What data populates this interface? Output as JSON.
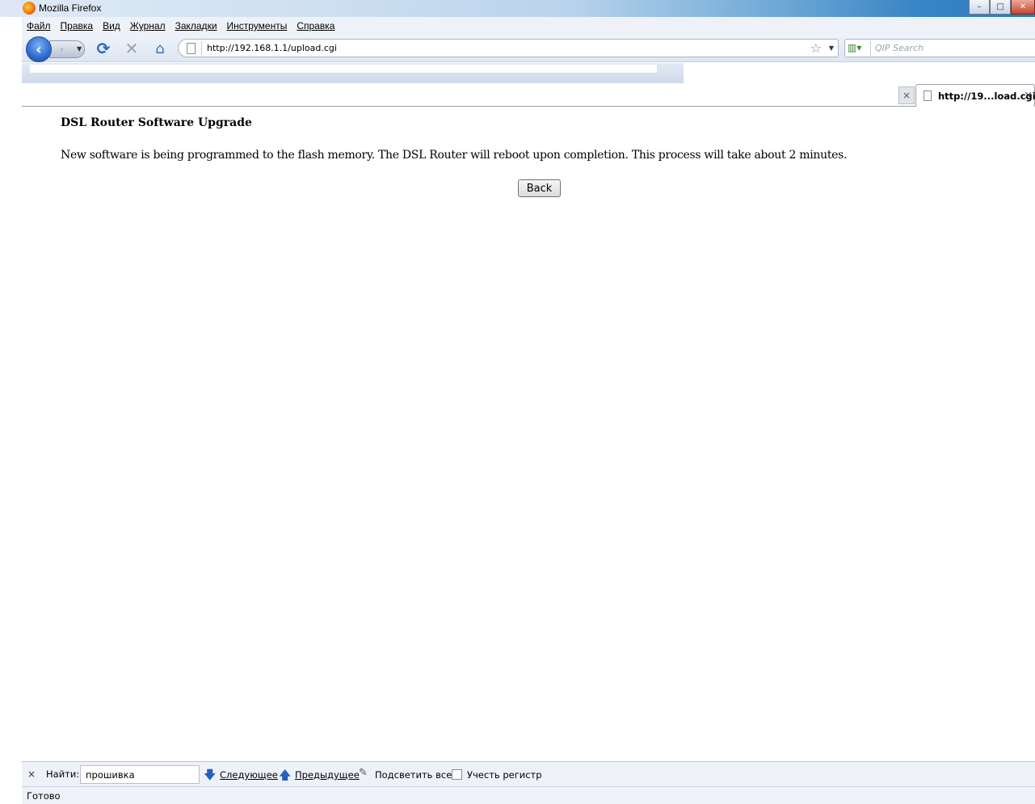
{
  "window": {
    "title": "Mozilla Firefox",
    "controls": {
      "minimize": "–",
      "maximize": "□",
      "close": "✕"
    }
  },
  "menu": {
    "items": [
      {
        "label": "Файл"
      },
      {
        "label": "Правка"
      },
      {
        "label": "Вид"
      },
      {
        "label": "Журнал"
      },
      {
        "label": "Закладки"
      },
      {
        "label": "Инструменты"
      },
      {
        "label": "Справка"
      }
    ]
  },
  "nav": {
    "url": "http://192.168.1.1/upload.cgi",
    "search_placeholder": "QIP Search",
    "icons": {
      "back": "‹",
      "forward": "›",
      "reload": "⟳",
      "stop": "✕",
      "home": "⌂",
      "star": "☆"
    }
  },
  "tabs": {
    "active_label": "http://19...load.cgi",
    "close": "×"
  },
  "page": {
    "heading": "DSL Router Software Upgrade",
    "message": "New software is being programmed to the flash memory. The DSL Router will reboot upon completion. This process will take about 2 minutes.",
    "back_button": "Back"
  },
  "findbar": {
    "close": "×",
    "label": "Найти:",
    "value": "прошивка",
    "next": "Следующее",
    "prev": "Предыдущее",
    "highlight": "Подсветить все",
    "match_case": "Учесть регистр",
    "icons": {
      "next": "🡇",
      "prev": "🡅",
      "highlight": "✎"
    }
  },
  "status": {
    "text": "Готово"
  }
}
